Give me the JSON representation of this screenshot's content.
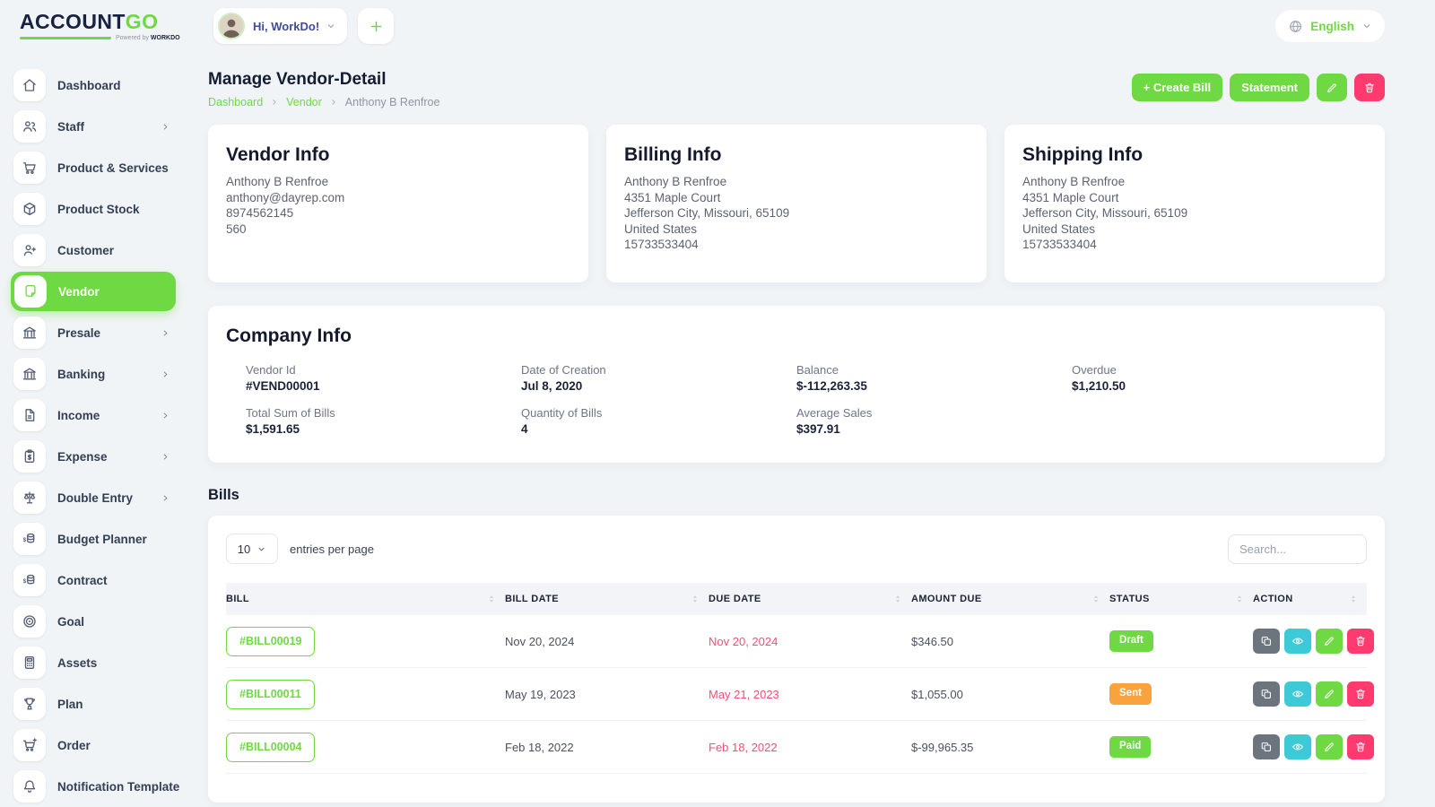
{
  "brand": {
    "name_a": "ACCOUNT",
    "name_b": "GO",
    "powered_by": "Powered by",
    "powered_brand": "WORKDO"
  },
  "topbar": {
    "greeting": "Hi, WorkDo!",
    "add_button": "+",
    "language": "English"
  },
  "sidebar": {
    "items": [
      {
        "label": "Dashboard",
        "icon": "home",
        "chevron": false,
        "active": false
      },
      {
        "label": "Staff",
        "icon": "users",
        "chevron": true,
        "active": false
      },
      {
        "label": "Product & Services",
        "icon": "cart",
        "chevron": false,
        "active": false
      },
      {
        "label": "Product Stock",
        "icon": "cube",
        "chevron": false,
        "active": false
      },
      {
        "label": "Customer",
        "icon": "user-plus",
        "chevron": false,
        "active": false
      },
      {
        "label": "Vendor",
        "icon": "note",
        "chevron": false,
        "active": true
      },
      {
        "label": "Presale",
        "icon": "bank",
        "chevron": true,
        "active": false
      },
      {
        "label": "Banking",
        "icon": "bank",
        "chevron": true,
        "active": false
      },
      {
        "label": "Income",
        "icon": "file",
        "chevron": true,
        "active": false
      },
      {
        "label": "Expense",
        "icon": "clipboard-dollar",
        "chevron": true,
        "active": false
      },
      {
        "label": "Double Entry",
        "icon": "scale",
        "chevron": true,
        "active": false
      },
      {
        "label": "Budget Planner",
        "icon": "coins",
        "chevron": false,
        "active": false
      },
      {
        "label": "Contract",
        "icon": "coins",
        "chevron": false,
        "active": false
      },
      {
        "label": "Goal",
        "icon": "target",
        "chevron": false,
        "active": false
      },
      {
        "label": "Assets",
        "icon": "calculator",
        "chevron": false,
        "active": false
      },
      {
        "label": "Plan",
        "icon": "trophy",
        "chevron": false,
        "active": false
      },
      {
        "label": "Order",
        "icon": "order-cart",
        "chevron": false,
        "active": false
      },
      {
        "label": "Notification Template",
        "icon": "bell",
        "chevron": false,
        "active": false
      }
    ]
  },
  "page": {
    "title": "Manage Vendor-Detail",
    "breadcrumb": [
      "Dashboard",
      "Vendor",
      "Anthony B Renfroe"
    ],
    "actions": {
      "create_bill": "+ Create Bill",
      "statement": "Statement"
    }
  },
  "info_cards": [
    {
      "title": "Vendor Info",
      "lines": [
        "Anthony B Renfroe",
        "anthony@dayrep.com",
        "8974562145",
        "560"
      ]
    },
    {
      "title": "Billing Info",
      "lines": [
        "Anthony B Renfroe",
        "4351 Maple Court",
        "Jefferson City, Missouri, 65109",
        "United States",
        "15733533404"
      ]
    },
    {
      "title": "Shipping Info",
      "lines": [
        "Anthony B Renfroe",
        "4351 Maple Court",
        "Jefferson City, Missouri, 65109",
        "United States",
        "15733533404"
      ]
    }
  ],
  "company_info": {
    "title": "Company Info",
    "fields": [
      {
        "label": "Vendor Id",
        "value": "#VEND00001"
      },
      {
        "label": "Date of Creation",
        "value": "Jul 8, 2020"
      },
      {
        "label": "Balance",
        "value": "$-112,263.35"
      },
      {
        "label": "Overdue",
        "value": "$1,210.50"
      },
      {
        "label": "Total Sum of Bills",
        "value": "$1,591.65"
      },
      {
        "label": "Quantity of Bills",
        "value": "4"
      },
      {
        "label": "Average Sales",
        "value": "$397.91"
      }
    ]
  },
  "bills": {
    "heading": "Bills",
    "per_page_value": "10",
    "per_page_label": "entries per page",
    "search_placeholder": "Search...",
    "columns": [
      "BILL",
      "BILL DATE",
      "DUE DATE",
      "AMOUNT DUE",
      "STATUS",
      "ACTION"
    ],
    "rows": [
      {
        "bill": "#BILL00019",
        "bill_date": "Nov 20, 2024",
        "due_date": "Nov 20, 2024",
        "amount_due": "$346.50",
        "status": "Draft",
        "status_color": "#6fd943"
      },
      {
        "bill": "#BILL00011",
        "bill_date": "May 19, 2023",
        "due_date": "May 21, 2023",
        "amount_due": "$1,055.00",
        "status": "Sent",
        "status_color": "#f9a33f"
      },
      {
        "bill": "#BILL00004",
        "bill_date": "Feb 18, 2022",
        "due_date": "Feb 18, 2022",
        "amount_due": "$-99,965.35",
        "status": "Paid",
        "status_color": "#6fd943"
      }
    ],
    "row_actions": [
      "duplicate",
      "view",
      "edit",
      "delete"
    ]
  },
  "colors": {
    "accent": "#6fd943",
    "danger": "#ff3a6e",
    "info": "#3ec9d6",
    "secondary": "#6c757d",
    "warning": "#f9a33f",
    "due_date": "#ff4d73"
  }
}
